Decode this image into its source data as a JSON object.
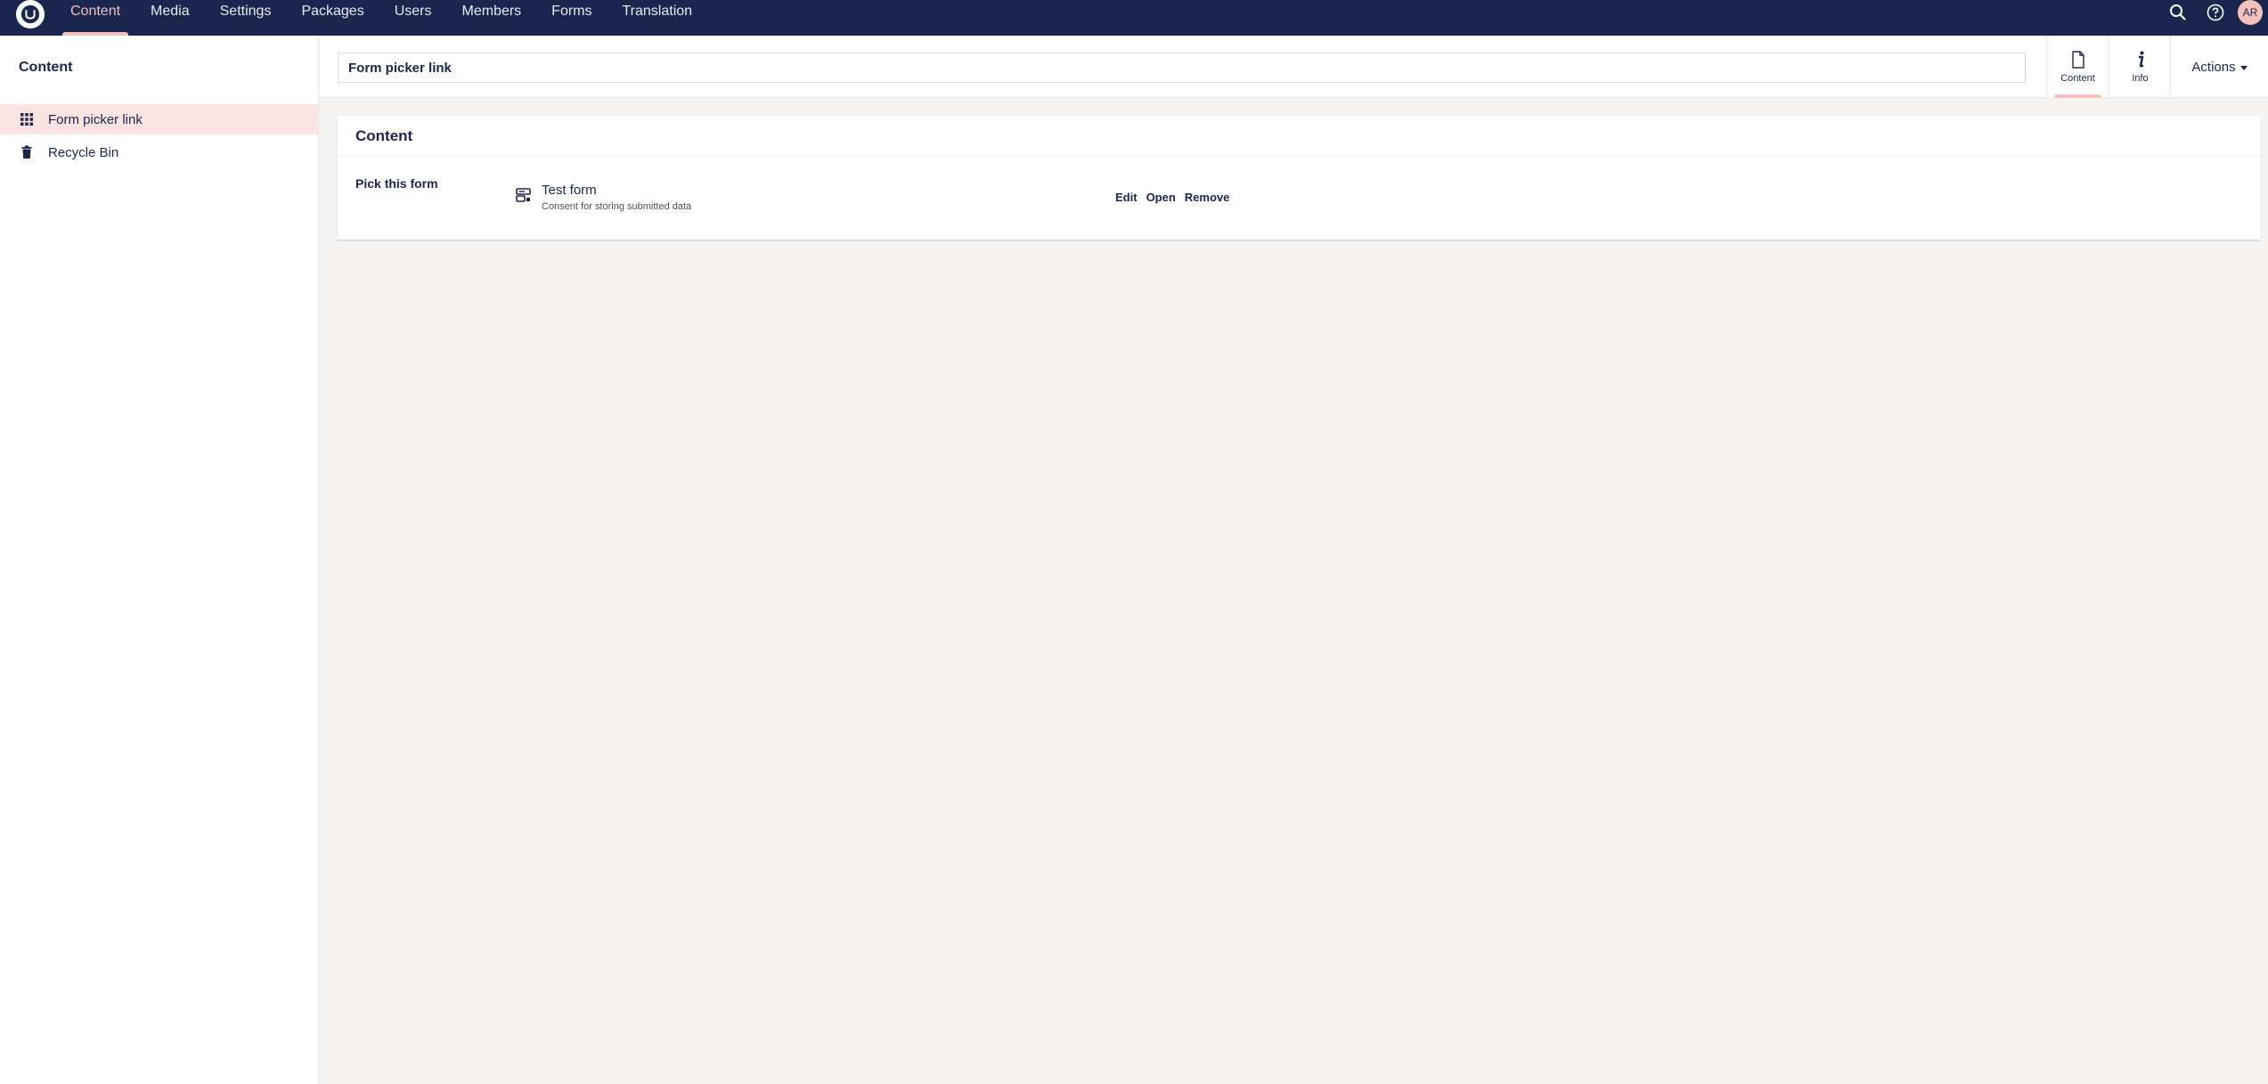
{
  "header": {
    "nav": [
      {
        "label": "Content",
        "active": true
      },
      {
        "label": "Media"
      },
      {
        "label": "Settings"
      },
      {
        "label": "Packages"
      },
      {
        "label": "Users"
      },
      {
        "label": "Members"
      },
      {
        "label": "Forms"
      },
      {
        "label": "Translation"
      }
    ],
    "search_icon": "search-icon",
    "help_icon": "help-icon",
    "avatar_initials": "AR"
  },
  "sidebar": {
    "title": "Content",
    "items": [
      {
        "label": "Form picker link",
        "icon": "grid-icon",
        "selected": true
      },
      {
        "label": "Recycle Bin",
        "icon": "trash-icon"
      }
    ]
  },
  "editor": {
    "name_value": "Form picker link",
    "tabs": [
      {
        "label": "Content",
        "icon": "document-icon",
        "active": true
      },
      {
        "label": "Info",
        "icon": "info-icon"
      }
    ],
    "actions_label": "Actions"
  },
  "panel": {
    "title": "Content",
    "property_label": "Pick this form",
    "form": {
      "name": "Test form",
      "description": "Consent for storing submitted data",
      "icon": "form-icon"
    },
    "node_actions": [
      "Edit",
      "Open",
      "Remove"
    ]
  },
  "colors": {
    "topbar": "#1b264f",
    "accent": "#f5c1bc",
    "selected_bg": "#fbe3e1",
    "background": "#f4f3f1"
  }
}
